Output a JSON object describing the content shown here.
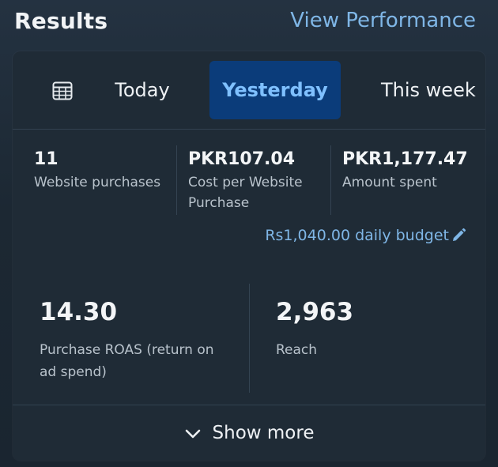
{
  "header": {
    "title": "Results",
    "view_link": "View Performance"
  },
  "tabs": {
    "calendar_icon": "calendar-icon",
    "items": [
      {
        "label": "Today",
        "selected": false
      },
      {
        "label": "Yesterday",
        "selected": true
      },
      {
        "label": "This week",
        "selected": false
      }
    ]
  },
  "metrics": [
    {
      "value": "11",
      "label": "Website purchases"
    },
    {
      "value": "PKR107.04",
      "label": "Cost per Website Purchase"
    },
    {
      "value": "PKR1,177.47",
      "label": "Amount spent"
    }
  ],
  "budget": {
    "text": "Rs1,040.00 daily budget",
    "icon": "pencil-icon"
  },
  "highlights": [
    {
      "value": "14.30",
      "label": "Purchase ROAS (return on ad spend)"
    },
    {
      "value": "2,963",
      "label": "Reach"
    }
  ],
  "footer": {
    "label": "Show more",
    "icon": "chevron-down-icon"
  },
  "colors": {
    "accent_link": "#7fb6e6",
    "selected_tab_bg": "#0b3c7a",
    "selected_tab_text": "#7fc0ff",
    "card_bg": "#1f2b36"
  }
}
